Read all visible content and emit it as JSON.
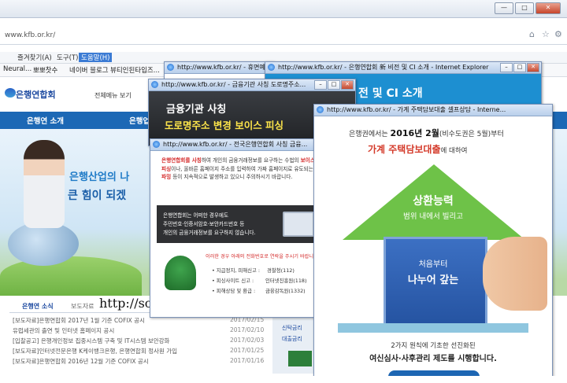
{
  "browser": {
    "address": "www.kfb.or.kr/",
    "menu": [
      "즐겨찾기(A)",
      "도구(T)",
      "도움말(H)"
    ],
    "favorites": [
      "Neural...",
      "뽀뽀찻수",
      "네이버 블로그",
      "뷰티인된타입즈..."
    ],
    "window_buttons": [
      "—",
      "□",
      "✕"
    ]
  },
  "site": {
    "logo": "은행연합회",
    "all_menu": "전체메뉴 보기",
    "nav": [
      "은행연 소개",
      "은행업무"
    ],
    "hero_line1": "은행산업의 나",
    "hero_line2": "큰 힘이 되겠",
    "news_tabs": [
      "은행연 소식",
      "보도자료"
    ],
    "news": [
      {
        "title": "[보도자료]은행연합회 2017년 1월 기준 COFIX 공시",
        "date": "2017/02/15"
      },
      {
        "title": "유럽세관의 출연 및 인터넷 홈페이지 공시",
        "date": "2017/02/10"
      },
      {
        "title": "[입찰공고] 은행개인정보 집중시스템 구축 및 IT시스템 보안강화",
        "date": "2017/02/03"
      },
      {
        "title": "[보도자료]인터넷전문은행 K케이뱅크은행, 은행연합회 정사원 가입",
        "date": "2017/01/25"
      },
      {
        "title": "[보도자료]은행연합회 2016년 12월 기준 COFIX 공시",
        "date": "2017/01/16"
      }
    ],
    "side_items": [
      "신탁금리",
      "대출금리"
    ],
    "watermark": "http://soopi.tistory.com/"
  },
  "popups": {
    "p1": {
      "title": "http://www.kfb.or.kr/ - 휴면예금..."
    },
    "p2": {
      "title": "http://www.kfb.or.kr/ - 은행연합회 新 비전 및 CI 소개 - Internet Explorer",
      "heading": "전 및 CI 소개"
    },
    "p3": {
      "title": "http://www.kfb.or.kr/ - 금융기관 사칭 도로명주소...",
      "line1": "금융기관 사칭",
      "line2": "도로명주소 변경 보이스 피싱"
    },
    "p4": {
      "title": "http://www.kfb.or.kr/ - 전국은행연합회 사칭 금융...",
      "para_red": "은행연합회를 사칭",
      "para_a": "하여 개인의 금융거래정보를 요구하는",
      "para_b": "수법의 ",
      "para_red2": "보이스피싱",
      "para_c": "이나, 올바른 홈페이지 주소를 입력하여",
      "para_d": "가짜 홈페이지로 유도되는 ",
      "para_red3": "파밍",
      "para_e": " 등이 지속적으로 발생하고",
      "para_f": "있으니 주의하시기 바랍니다.",
      "box_line1": "은행연합회는 어떠한 경우에도",
      "box_line2": "주민번호·인증서암호·보안카드번호 등",
      "box_line3": "개인의 금융거래정보를 요구하지 않습니다.",
      "question": "이러한 경우 아래의 전화번호로 연락을 주시기 바랍니다",
      "contacts": [
        {
          "label": "• 지급정지, 피해신고 :",
          "value": "경찰청(112)"
        },
        {
          "label": "• 피싱사이트 신고 :",
          "value": "인터넷진흥원(118)"
        },
        {
          "label": "• 피해상담 및 환급 :",
          "value": "금융감독원(1332)"
        }
      ]
    },
    "p5": {
      "title": "http://www.kfb.or.kr/ - 가계 주택담보대출 셀프상담 - Interne...",
      "l1_pre": "은행권에서는 ",
      "l1_bold": "2016년 2월",
      "l1_post": "(비수도권은 5월)부터",
      "l2": "가계 주택담보대출",
      "l2_tail": "에 대하여",
      "arrow1": "상환능력",
      "arrow2": "범위 내에서 빌리고",
      "box1": "처음부터",
      "box2": "나누어 갚는",
      "bottom1": "2가지 원칙에 기초한 선진화된",
      "bottom2": "여신심사·사후관리 제도를 시행합니다."
    }
  }
}
